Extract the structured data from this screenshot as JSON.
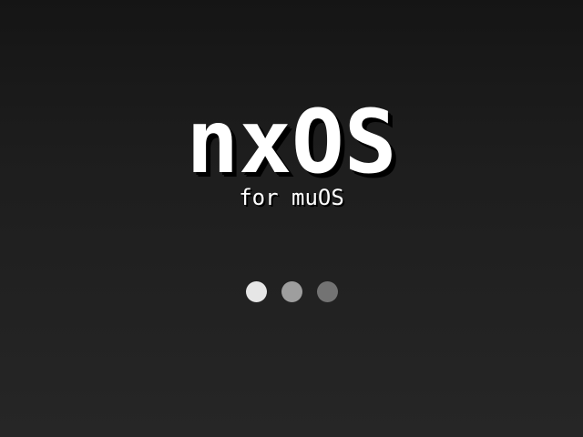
{
  "splash": {
    "title": "nxOS",
    "subtitle": "for muOS"
  },
  "loading_indicator": {
    "dots": [
      {
        "color": "#e6e6e6"
      },
      {
        "color": "#9e9e9e"
      },
      {
        "color": "#737373"
      }
    ]
  },
  "colors": {
    "text": "#ffffff",
    "shadow": "#000000",
    "background_top": "#151515",
    "background_bottom": "#262626"
  }
}
